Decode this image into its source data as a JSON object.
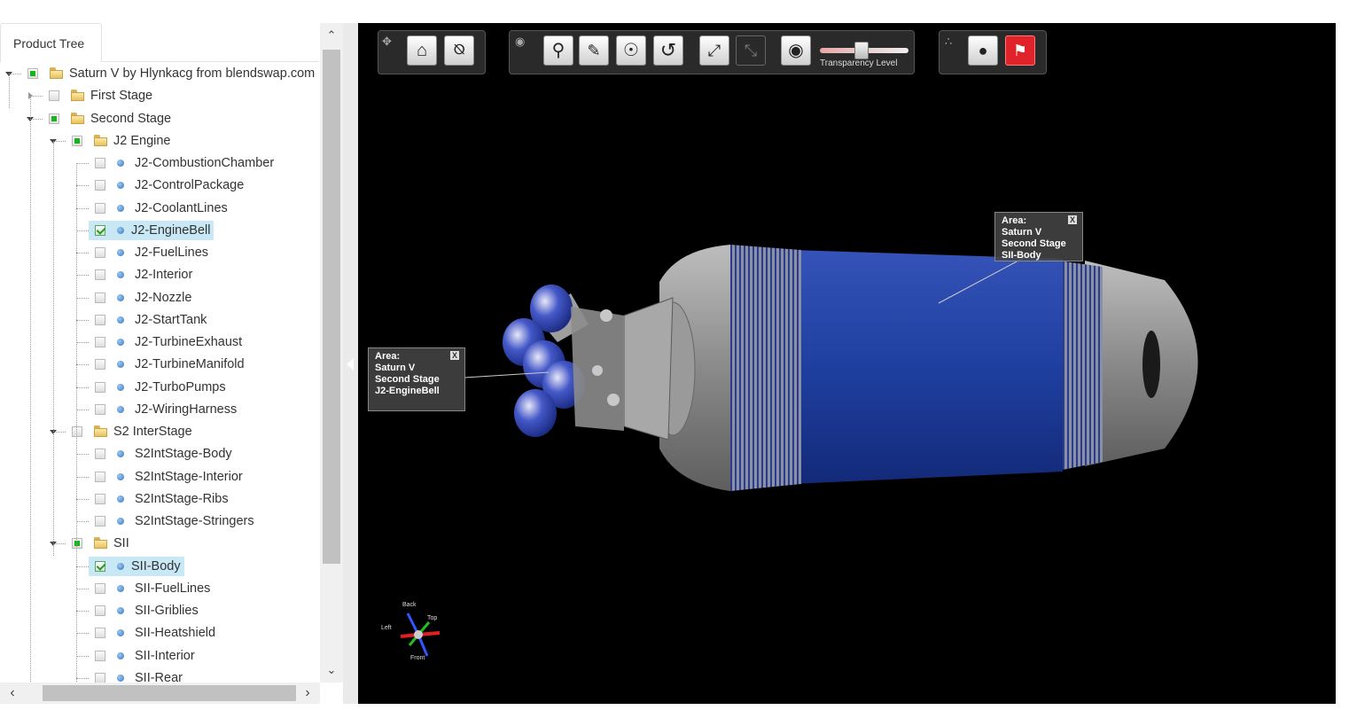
{
  "tab": {
    "label": "Product Tree"
  },
  "tree": [
    {
      "label": "Saturn V by Hlynkacg from blendswap.com",
      "level": 0,
      "kind": "folder",
      "state": "partial",
      "expanded": true
    },
    {
      "label": "First Stage",
      "level": 1,
      "kind": "folder",
      "state": "none",
      "expanded": false
    },
    {
      "label": "Second Stage",
      "level": 1,
      "kind": "folder",
      "state": "partial",
      "expanded": true
    },
    {
      "label": "J2 Engine",
      "level": 2,
      "kind": "folder",
      "state": "partial",
      "expanded": true
    },
    {
      "label": "J2-CombustionChamber",
      "level": 3,
      "kind": "part",
      "state": "none"
    },
    {
      "label": "J2-ControlPackage",
      "level": 3,
      "kind": "part",
      "state": "none"
    },
    {
      "label": "J2-CoolantLines",
      "level": 3,
      "kind": "part",
      "state": "none"
    },
    {
      "label": "J2-EngineBell",
      "level": 3,
      "kind": "part",
      "state": "checked",
      "selected": true
    },
    {
      "label": "J2-FuelLines",
      "level": 3,
      "kind": "part",
      "state": "none"
    },
    {
      "label": "J2-Interior",
      "level": 3,
      "kind": "part",
      "state": "none"
    },
    {
      "label": "J2-Nozzle",
      "level": 3,
      "kind": "part",
      "state": "none"
    },
    {
      "label": "J2-StartTank",
      "level": 3,
      "kind": "part",
      "state": "none"
    },
    {
      "label": "J2-TurbineExhaust",
      "level": 3,
      "kind": "part",
      "state": "none"
    },
    {
      "label": "J2-TurbineManifold",
      "level": 3,
      "kind": "part",
      "state": "none"
    },
    {
      "label": "J2-TurboPumps",
      "level": 3,
      "kind": "part",
      "state": "none"
    },
    {
      "label": "J2-WiringHarness",
      "level": 3,
      "kind": "part",
      "state": "none"
    },
    {
      "label": "S2 InterStage",
      "level": 2,
      "kind": "folder",
      "state": "none",
      "expanded": true
    },
    {
      "label": "S2IntStage-Body",
      "level": 3,
      "kind": "part",
      "state": "none"
    },
    {
      "label": "S2IntStage-Interior",
      "level": 3,
      "kind": "part",
      "state": "none"
    },
    {
      "label": "S2IntStage-Ribs",
      "level": 3,
      "kind": "part",
      "state": "none"
    },
    {
      "label": "S2IntStage-Stringers",
      "level": 3,
      "kind": "part",
      "state": "none"
    },
    {
      "label": "SII",
      "level": 2,
      "kind": "folder",
      "state": "partial",
      "expanded": true
    },
    {
      "label": "SII-Body",
      "level": 3,
      "kind": "part",
      "state": "checked",
      "selected": true
    },
    {
      "label": "SII-FuelLines",
      "level": 3,
      "kind": "part",
      "state": "none"
    },
    {
      "label": "SII-Griblies",
      "level": 3,
      "kind": "part",
      "state": "none"
    },
    {
      "label": "SII-Heatshield",
      "level": 3,
      "kind": "part",
      "state": "none"
    },
    {
      "label": "SII-Interior",
      "level": 3,
      "kind": "part",
      "state": "none"
    },
    {
      "label": "SII-Rear",
      "level": 3,
      "kind": "part",
      "state": "none"
    }
  ],
  "toolbar": {
    "transparency_label": "Transparency Level",
    "transparency_level": 0.45,
    "icons": [
      "move-icon",
      "home-icon",
      "section-icon",
      "view-icon",
      "zoom-fit-icon",
      "eraser-icon",
      "eye-icon",
      "rotate-icon",
      "shrink-icon",
      "expand-icon",
      "transparency-icon",
      "tree-icon",
      "hide-icon",
      "flag-icon"
    ]
  },
  "callouts": [
    {
      "lines": [
        "Area:",
        "Saturn V",
        "Second Stage",
        "J2-EngineBell"
      ],
      "close": "X"
    },
    {
      "lines": [
        "Area:",
        "Saturn V",
        "Second Stage",
        "SII-Body"
      ],
      "close": "X"
    }
  ],
  "axis": {
    "back": "Back",
    "top": "Top",
    "left": "Left",
    "front": "Front"
  },
  "colors": {
    "body_blue": "#1f3fa0",
    "selection": "#c8e8f6",
    "flag_red": "#e0232a",
    "check_green": "#19b419"
  }
}
